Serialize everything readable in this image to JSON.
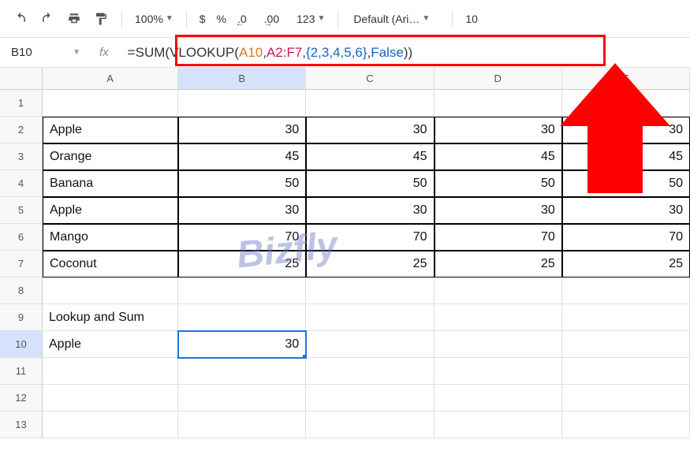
{
  "toolbar": {
    "zoom": "100%",
    "currency": "$",
    "percent": "%",
    "dec_dec": ".0",
    "dec_inc": ".00",
    "numfmt": "123",
    "font": "Default (Ari…",
    "font_size": "10"
  },
  "cellname": "B10",
  "formula": {
    "raw": "=SUM(VLOOKUP(A10,A2:F7,{2,3,4,5,6},False))",
    "prefix": "=SUM",
    "open1": "(",
    "fn": "VLOOKUP",
    "open2": "(",
    "ref1": "A10",
    "c1": ",",
    "ref2": "A2:F7",
    "c2": ",",
    "arr": "{2,3,4,5,6}",
    "c3": ",",
    "bool": "False",
    "close": "))"
  },
  "columns": [
    "A",
    "B",
    "C",
    "D",
    "E"
  ],
  "rows": [
    {
      "n": "1",
      "cells": [
        "",
        "",
        "",
        "",
        ""
      ],
      "border": false
    },
    {
      "n": "2",
      "cells": [
        "Apple",
        "30",
        "30",
        "30",
        "30"
      ],
      "border": true
    },
    {
      "n": "3",
      "cells": [
        "Orange",
        "45",
        "45",
        "45",
        "45"
      ],
      "border": true
    },
    {
      "n": "4",
      "cells": [
        "Banana",
        "50",
        "50",
        "50",
        "50"
      ],
      "border": true
    },
    {
      "n": "5",
      "cells": [
        "Apple",
        "30",
        "30",
        "30",
        "30"
      ],
      "border": true
    },
    {
      "n": "6",
      "cells": [
        "Mango",
        "70",
        "70",
        "70",
        "70"
      ],
      "border": true
    },
    {
      "n": "7",
      "cells": [
        "Coconut",
        "25",
        "25",
        "25",
        "25"
      ],
      "border": true
    },
    {
      "n": "8",
      "cells": [
        "",
        "",
        "",
        "",
        ""
      ],
      "border": false
    },
    {
      "n": "9",
      "cells": [
        "Lookup and Sum",
        "",
        "",
        "",
        ""
      ],
      "border": false
    },
    {
      "n": "10",
      "cells": [
        "Apple",
        "30",
        "",
        "",
        ""
      ],
      "border": false
    },
    {
      "n": "11",
      "cells": [
        "",
        "",
        "",
        "",
        ""
      ],
      "border": false
    },
    {
      "n": "12",
      "cells": [
        "",
        "",
        "",
        "",
        ""
      ],
      "border": false
    },
    {
      "n": "13",
      "cells": [
        "",
        "",
        "",
        "",
        ""
      ],
      "border": false
    }
  ],
  "selected": {
    "row": "10",
    "col": "B"
  },
  "watermark": "Bizfly"
}
